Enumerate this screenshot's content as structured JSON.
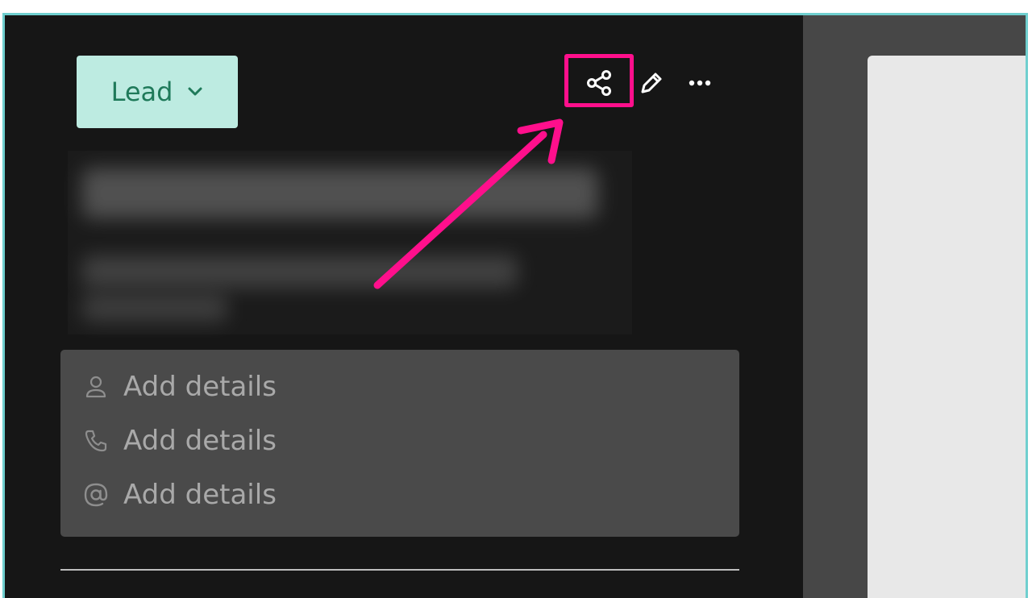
{
  "status": {
    "label": "Lead"
  },
  "toolbar": {
    "share_icon": "share-icon",
    "edit_icon": "pencil-icon",
    "more_icon": "more-horizontal-icon",
    "highlight_color": "#ff0f8c"
  },
  "details": [
    {
      "icon": "person-icon",
      "label": "Add details"
    },
    {
      "icon": "phone-icon",
      "label": "Add details"
    },
    {
      "icon": "at-sign-icon",
      "label": "Add details"
    }
  ],
  "colors": {
    "status_bg": "#bdebe1",
    "status_text": "#1f7a5a",
    "annotation": "#ff0f8c",
    "frame": "#6fcfcf"
  }
}
